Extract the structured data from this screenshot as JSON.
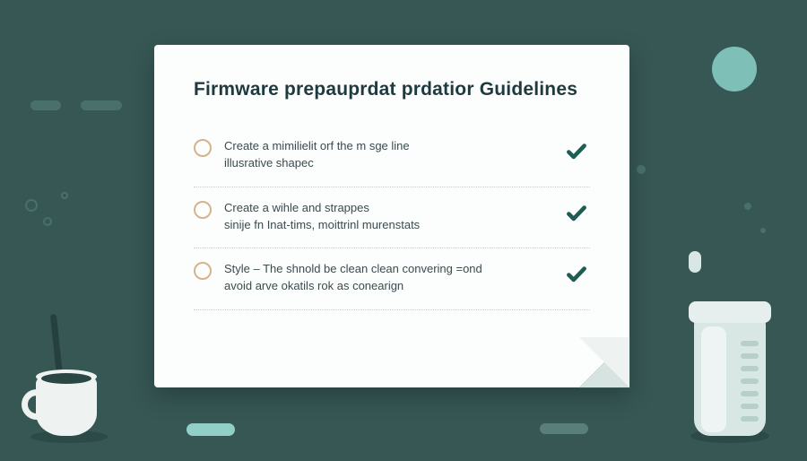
{
  "card": {
    "title": "Firmware prepauprdat prdatior Guidelines",
    "items": [
      {
        "line1": "Create a mimilielit orf the m sge line",
        "line2": "illusrative shapec"
      },
      {
        "line1": "Create a wihle and strappes",
        "line2": "sinije fn Inat-tims, moittrinl murenstats"
      },
      {
        "line1": "Style – The shnold be clean clean convering =ond",
        "line2": "avoid arve okatils rok as conearign"
      }
    ]
  }
}
